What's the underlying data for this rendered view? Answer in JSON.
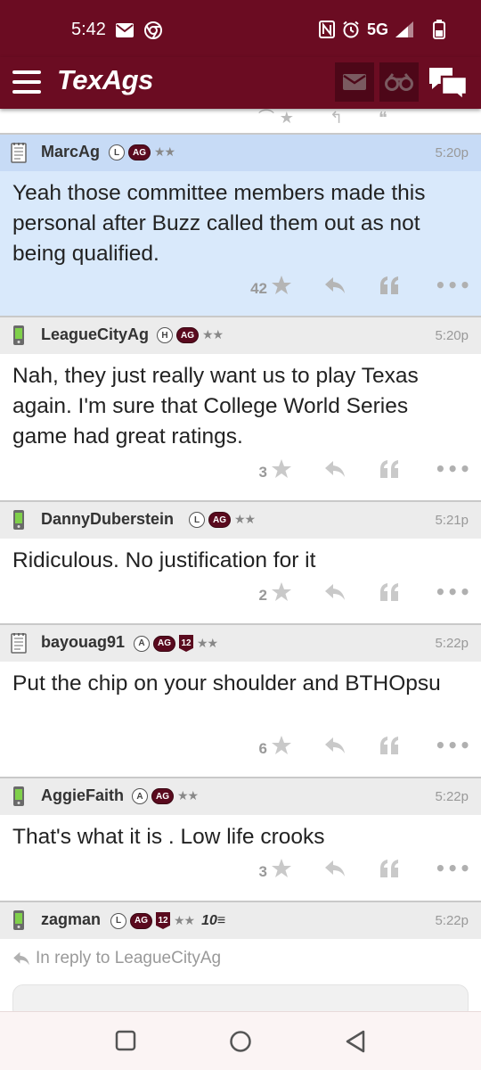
{
  "status_bar": {
    "time": "5:42",
    "network": "5G",
    "left_icons": [
      "mail-icon",
      "chrome-icon"
    ],
    "right_icons": [
      "nfc-icon",
      "alarm-icon",
      "signal-icon",
      "battery-icon"
    ]
  },
  "header": {
    "logo": "TexAgs",
    "brand_color": "#6b0c22",
    "buttons": [
      "mail-icon",
      "binoculars-icon",
      "chat-icon"
    ]
  },
  "posts": [
    {
      "username": "MarcAg",
      "device": "notepad-icon",
      "badges": [
        "L",
        "AG"
      ],
      "stars": "★★",
      "time": "5:20p",
      "body": "Yeah those committee members made this personal after Buzz called them out as not being qualified.",
      "likes": "42",
      "highlighted": true
    },
    {
      "username": "LeagueCityAg",
      "device": "phone-icon",
      "badges": [
        "H",
        "AG"
      ],
      "stars": "★★",
      "time": "5:20p",
      "body": "Nah, they just really want us to play Texas again. I'm sure that College World Series game had great ratings.",
      "likes": "3",
      "highlighted": false
    },
    {
      "username": "DannyDuberstein",
      "device": "phone-icon",
      "badges": [
        "L",
        "AG"
      ],
      "stars": "★★",
      "time": "5:21p",
      "body": "Ridiculous. No justification for it",
      "likes": "2",
      "highlighted": false
    },
    {
      "username": "bayouag91",
      "device": "notepad-icon",
      "badges": [
        "A",
        "AG",
        "12"
      ],
      "stars": "★★",
      "time": "5:22p",
      "body": "Put the chip on your shoulder and BTHOpsu",
      "likes": "6",
      "highlighted": false
    },
    {
      "username": "AggieFaith",
      "device": "phone-icon",
      "badges": [
        "A",
        "AG"
      ],
      "stars": "★★",
      "time": "5:22p",
      "body": "That's what it is . Low life crooks",
      "likes": "3",
      "highlighted": false
    },
    {
      "username": "zagman",
      "device": "phone-icon",
      "badges": [
        "L",
        "AG",
        "12"
      ],
      "stars": "★★",
      "extra_badge": "10",
      "time": "5:22p"
    }
  ],
  "reply": {
    "text": "In reply to LeagueCityAg"
  },
  "nav": {
    "buttons": [
      "recents-square-icon",
      "home-circle-icon",
      "back-triangle-icon"
    ]
  }
}
